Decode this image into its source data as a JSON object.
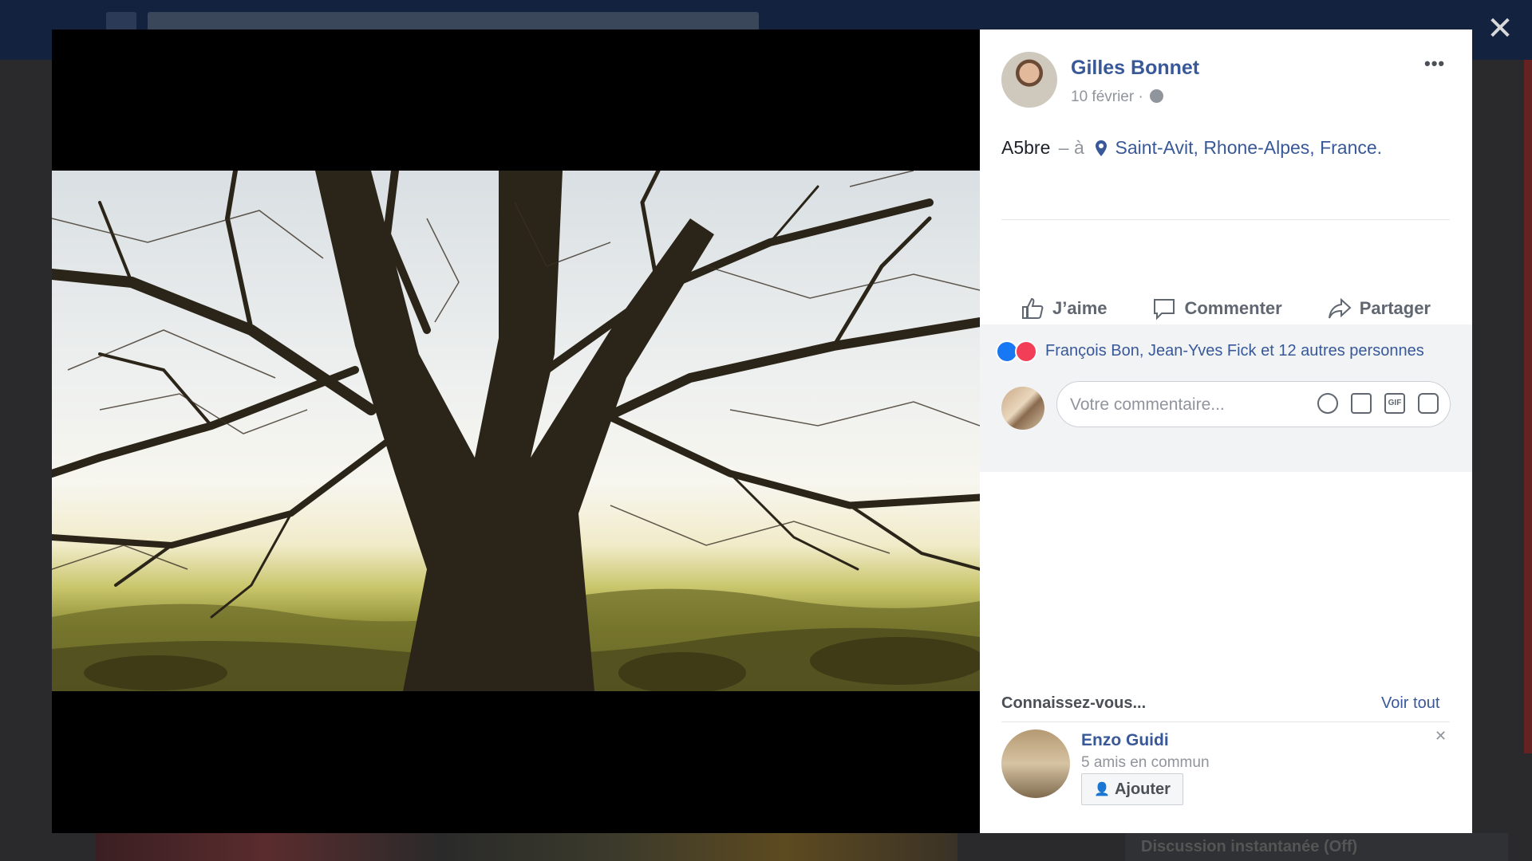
{
  "post": {
    "author": "Gilles Bonnet",
    "date": "10 février",
    "date_sep": "·",
    "caption_text": "A5bre",
    "caption_sep": "– à",
    "location": "Saint-Avit, Rhone-Alpes, France."
  },
  "actions": {
    "like": "J’aime",
    "comment": "Commenter",
    "share": "Partager"
  },
  "reactions": {
    "text": "François Bon, Jean-Yves Fick et 12 autres personnes"
  },
  "comment": {
    "placeholder": "Votre commentaire..."
  },
  "pymk": {
    "title": "Connaissez-vous...",
    "see_all": "Voir tout",
    "friend": {
      "name": "Enzo Guidi",
      "mutual": "5 amis en commun",
      "add_label": "Ajouter"
    }
  },
  "background": {
    "chat_label": "Discussion instantanée (Off)"
  },
  "colors": {
    "link": "#385898",
    "like": "#1877f2",
    "love": "#f33e58"
  },
  "icons": [
    "close-icon",
    "more-icon",
    "globe-icon",
    "pin-icon",
    "like-icon",
    "comment-icon",
    "share-icon",
    "emoji-icon",
    "camera-icon",
    "gif-icon",
    "sticker-icon",
    "add-friend-icon"
  ]
}
